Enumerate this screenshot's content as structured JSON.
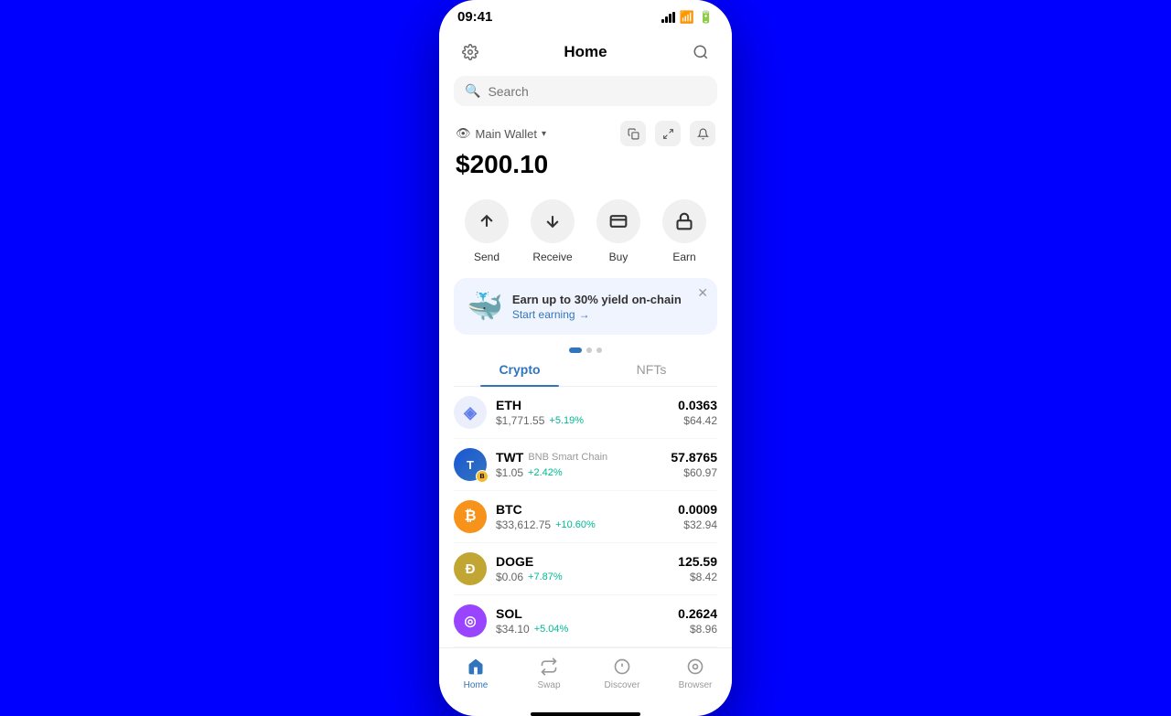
{
  "status": {
    "time": "09:41"
  },
  "header": {
    "title": "Home",
    "settings_label": "⚙",
    "scan_label": "🔗"
  },
  "search": {
    "placeholder": "Search"
  },
  "wallet": {
    "name": "Main Wallet",
    "balance": "$200.10",
    "copy_label": "copy",
    "expand_label": "expand",
    "bell_label": "bell"
  },
  "actions": [
    {
      "id": "send",
      "label": "Send",
      "icon": "↑"
    },
    {
      "id": "receive",
      "label": "Receive",
      "icon": "↓"
    },
    {
      "id": "buy",
      "label": "Buy",
      "icon": "⊟"
    },
    {
      "id": "earn",
      "label": "Earn",
      "icon": "🔒"
    }
  ],
  "promo": {
    "title": "Earn up to 30% yield on-chain",
    "link": "Start earning",
    "arrow": "→"
  },
  "tabs": [
    {
      "id": "crypto",
      "label": "Crypto",
      "active": true
    },
    {
      "id": "nfts",
      "label": "NFTs",
      "active": false
    }
  ],
  "assets": [
    {
      "symbol": "ETH",
      "name": "ETH",
      "chain": "",
      "price": "$1,771.55",
      "change": "+5.19%",
      "amount": "0.0363",
      "value": "$64.42",
      "color": "#627EEA",
      "icon": "◈"
    },
    {
      "symbol": "TWT",
      "name": "TWT",
      "chain": "BNB Smart Chain",
      "price": "$1.05",
      "change": "+2.42%",
      "amount": "57.8765",
      "value": "$60.97",
      "color": "#1196C1",
      "icon": "T"
    },
    {
      "symbol": "BTC",
      "name": "BTC",
      "chain": "",
      "price": "$33,612.75",
      "change": "+10.60%",
      "amount": "0.0009",
      "value": "$32.94",
      "color": "#F7931A",
      "icon": "₿"
    },
    {
      "symbol": "DOGE",
      "name": "DOGE",
      "chain": "",
      "price": "$0.06",
      "change": "+7.87%",
      "amount": "125.59",
      "value": "$8.42",
      "color": "#C2A633",
      "icon": "Ð"
    },
    {
      "symbol": "SOL",
      "name": "SOL",
      "chain": "",
      "price": "$34.10",
      "change": "+5.04%",
      "amount": "0.2624",
      "value": "$8.96",
      "color": "#9945FF",
      "icon": "◎"
    }
  ],
  "nav": [
    {
      "id": "home",
      "label": "Home",
      "icon": "⌂",
      "active": true
    },
    {
      "id": "swap",
      "label": "Swap",
      "icon": "⇄",
      "active": false
    },
    {
      "id": "discover",
      "label": "Discover",
      "icon": "💡",
      "active": false
    },
    {
      "id": "browser",
      "label": "Browser",
      "icon": "◉",
      "active": false
    }
  ]
}
